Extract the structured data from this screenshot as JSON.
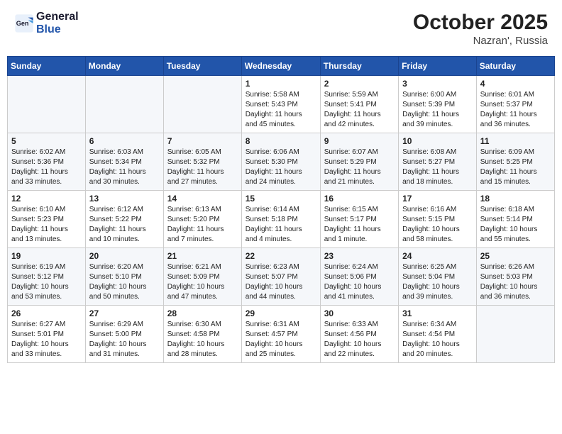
{
  "header": {
    "logo_line1": "General",
    "logo_line2": "Blue",
    "month": "October 2025",
    "location": "Nazran', Russia"
  },
  "days_of_week": [
    "Sunday",
    "Monday",
    "Tuesday",
    "Wednesday",
    "Thursday",
    "Friday",
    "Saturday"
  ],
  "weeks": [
    [
      {
        "day": "",
        "info": ""
      },
      {
        "day": "",
        "info": ""
      },
      {
        "day": "",
        "info": ""
      },
      {
        "day": "1",
        "info": "Sunrise: 5:58 AM\nSunset: 5:43 PM\nDaylight: 11 hours\nand 45 minutes."
      },
      {
        "day": "2",
        "info": "Sunrise: 5:59 AM\nSunset: 5:41 PM\nDaylight: 11 hours\nand 42 minutes."
      },
      {
        "day": "3",
        "info": "Sunrise: 6:00 AM\nSunset: 5:39 PM\nDaylight: 11 hours\nand 39 minutes."
      },
      {
        "day": "4",
        "info": "Sunrise: 6:01 AM\nSunset: 5:37 PM\nDaylight: 11 hours\nand 36 minutes."
      }
    ],
    [
      {
        "day": "5",
        "info": "Sunrise: 6:02 AM\nSunset: 5:36 PM\nDaylight: 11 hours\nand 33 minutes."
      },
      {
        "day": "6",
        "info": "Sunrise: 6:03 AM\nSunset: 5:34 PM\nDaylight: 11 hours\nand 30 minutes."
      },
      {
        "day": "7",
        "info": "Sunrise: 6:05 AM\nSunset: 5:32 PM\nDaylight: 11 hours\nand 27 minutes."
      },
      {
        "day": "8",
        "info": "Sunrise: 6:06 AM\nSunset: 5:30 PM\nDaylight: 11 hours\nand 24 minutes."
      },
      {
        "day": "9",
        "info": "Sunrise: 6:07 AM\nSunset: 5:29 PM\nDaylight: 11 hours\nand 21 minutes."
      },
      {
        "day": "10",
        "info": "Sunrise: 6:08 AM\nSunset: 5:27 PM\nDaylight: 11 hours\nand 18 minutes."
      },
      {
        "day": "11",
        "info": "Sunrise: 6:09 AM\nSunset: 5:25 PM\nDaylight: 11 hours\nand 15 minutes."
      }
    ],
    [
      {
        "day": "12",
        "info": "Sunrise: 6:10 AM\nSunset: 5:23 PM\nDaylight: 11 hours\nand 13 minutes."
      },
      {
        "day": "13",
        "info": "Sunrise: 6:12 AM\nSunset: 5:22 PM\nDaylight: 11 hours\nand 10 minutes."
      },
      {
        "day": "14",
        "info": "Sunrise: 6:13 AM\nSunset: 5:20 PM\nDaylight: 11 hours\nand 7 minutes."
      },
      {
        "day": "15",
        "info": "Sunrise: 6:14 AM\nSunset: 5:18 PM\nDaylight: 11 hours\nand 4 minutes."
      },
      {
        "day": "16",
        "info": "Sunrise: 6:15 AM\nSunset: 5:17 PM\nDaylight: 11 hours\nand 1 minute."
      },
      {
        "day": "17",
        "info": "Sunrise: 6:16 AM\nSunset: 5:15 PM\nDaylight: 10 hours\nand 58 minutes."
      },
      {
        "day": "18",
        "info": "Sunrise: 6:18 AM\nSunset: 5:14 PM\nDaylight: 10 hours\nand 55 minutes."
      }
    ],
    [
      {
        "day": "19",
        "info": "Sunrise: 6:19 AM\nSunset: 5:12 PM\nDaylight: 10 hours\nand 53 minutes."
      },
      {
        "day": "20",
        "info": "Sunrise: 6:20 AM\nSunset: 5:10 PM\nDaylight: 10 hours\nand 50 minutes."
      },
      {
        "day": "21",
        "info": "Sunrise: 6:21 AM\nSunset: 5:09 PM\nDaylight: 10 hours\nand 47 minutes."
      },
      {
        "day": "22",
        "info": "Sunrise: 6:23 AM\nSunset: 5:07 PM\nDaylight: 10 hours\nand 44 minutes."
      },
      {
        "day": "23",
        "info": "Sunrise: 6:24 AM\nSunset: 5:06 PM\nDaylight: 10 hours\nand 41 minutes."
      },
      {
        "day": "24",
        "info": "Sunrise: 6:25 AM\nSunset: 5:04 PM\nDaylight: 10 hours\nand 39 minutes."
      },
      {
        "day": "25",
        "info": "Sunrise: 6:26 AM\nSunset: 5:03 PM\nDaylight: 10 hours\nand 36 minutes."
      }
    ],
    [
      {
        "day": "26",
        "info": "Sunrise: 6:27 AM\nSunset: 5:01 PM\nDaylight: 10 hours\nand 33 minutes."
      },
      {
        "day": "27",
        "info": "Sunrise: 6:29 AM\nSunset: 5:00 PM\nDaylight: 10 hours\nand 31 minutes."
      },
      {
        "day": "28",
        "info": "Sunrise: 6:30 AM\nSunset: 4:58 PM\nDaylight: 10 hours\nand 28 minutes."
      },
      {
        "day": "29",
        "info": "Sunrise: 6:31 AM\nSunset: 4:57 PM\nDaylight: 10 hours\nand 25 minutes."
      },
      {
        "day": "30",
        "info": "Sunrise: 6:33 AM\nSunset: 4:56 PM\nDaylight: 10 hours\nand 22 minutes."
      },
      {
        "day": "31",
        "info": "Sunrise: 6:34 AM\nSunset: 4:54 PM\nDaylight: 10 hours\nand 20 minutes."
      },
      {
        "day": "",
        "info": ""
      }
    ]
  ]
}
